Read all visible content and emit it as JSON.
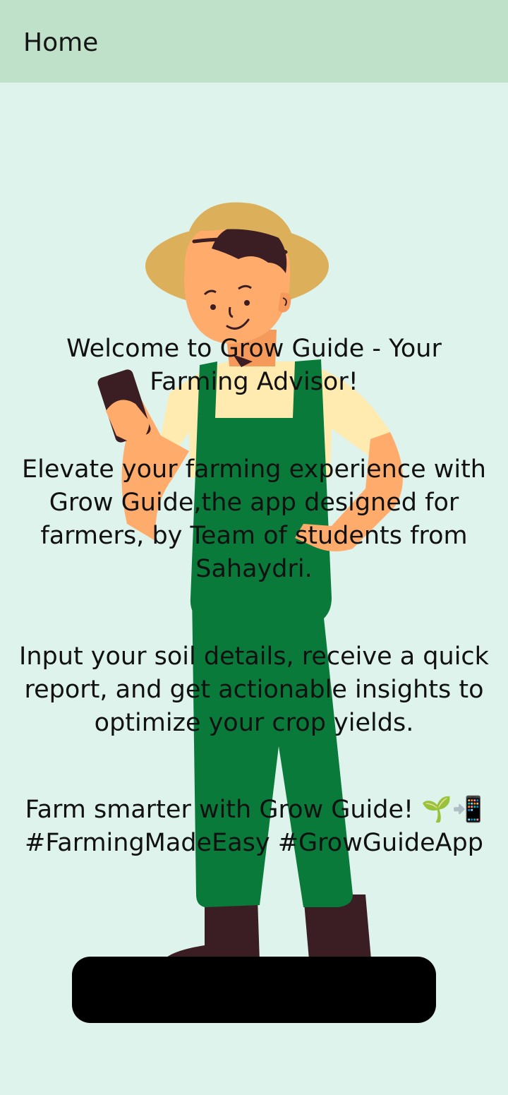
{
  "app_bar": {
    "title": "Home"
  },
  "main": {
    "welcome": "Welcome to Grow Guide - Your Farming Advisor!",
    "intro": "Elevate your farming experience with Grow Guide,the app designed for farmers, by Team of students from Sahaydri.",
    "how_it_works": "Input your soil details, receive a quick report, and get actionable insights to optimize your crop yields.",
    "tagline": "Farm smarter with Grow Guide! 🌱📲 #FarmingMadeEasy #GrowGuideApp"
  },
  "colors": {
    "app_bar_bg": "#c0e1c9",
    "page_bg": "#ddf3ec",
    "overalls": "#0a7a3a",
    "hat": "#dcb05a",
    "skin": "#ffab6b",
    "shirt": "#ffeab0",
    "boots": "#3a1e24",
    "button_bg": "#000000"
  },
  "illustration": {
    "icon": "farmer-illustration"
  }
}
